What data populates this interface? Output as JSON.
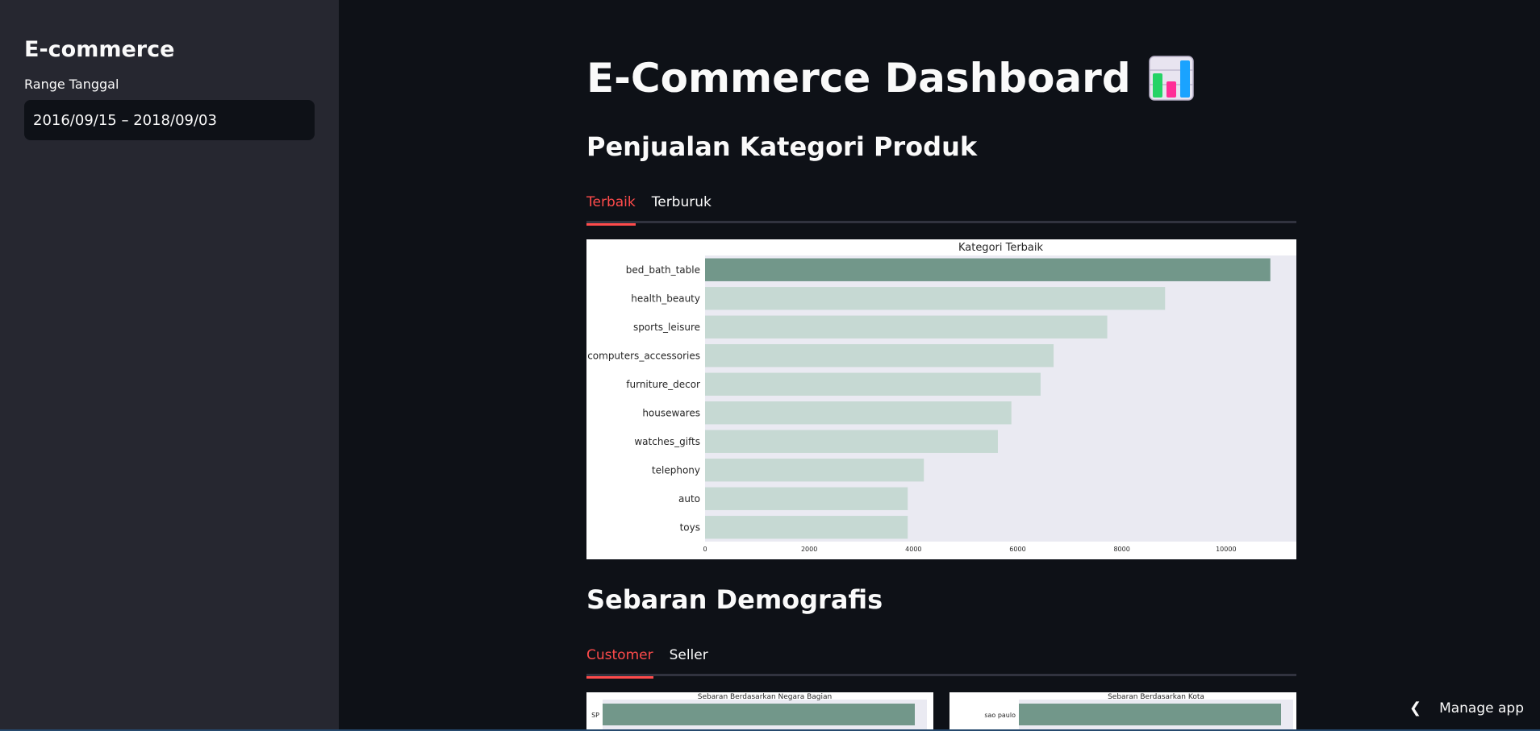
{
  "sidebar": {
    "title": "E-commerce",
    "date_label": "Range Tanggal",
    "date_value": "2016/09/15 – 2018/09/03"
  },
  "main": {
    "title": "E-Commerce Dashboard",
    "title_icon": "bar-chart-icon",
    "section1": {
      "heading": "Penjualan Kategori Produk",
      "tabs": [
        {
          "label": "Terbaik",
          "active": true
        },
        {
          "label": "Terburuk",
          "active": false
        }
      ]
    },
    "section2": {
      "heading": "Sebaran Demografis",
      "tabs": [
        {
          "label": "Customer",
          "active": true
        },
        {
          "label": "Seller",
          "active": false
        }
      ]
    }
  },
  "manage_app": "Manage app",
  "colors": {
    "accent": "#ff4b4b",
    "bar_top": "#72978a",
    "bar_rest": "#c6d9d3",
    "plot_bg": "#eaeaf2"
  },
  "chart_data": [
    {
      "type": "bar",
      "orientation": "horizontal",
      "title": "Kategori Terbaik",
      "categories": [
        "bed_bath_table",
        "health_beauty",
        "sports_leisure",
        "computers_accessories",
        "furniture_decor",
        "housewares",
        "watches_gifts",
        "telephony",
        "auto",
        "toys"
      ],
      "values": [
        10850,
        8830,
        7720,
        6690,
        6440,
        5880,
        5620,
        4200,
        3890,
        3890
      ],
      "xticks": [
        0,
        2000,
        4000,
        6000,
        8000,
        10000
      ],
      "xlim": [
        0,
        11350
      ],
      "grid": false
    },
    {
      "type": "bar",
      "orientation": "horizontal",
      "title": "Sebaran Berdasarkan Negara Bagian",
      "categories": [
        "SP"
      ],
      "values": [
        1.0
      ]
    },
    {
      "type": "bar",
      "orientation": "horizontal",
      "title": "Sebaran Berdasarkan Kota",
      "categories": [
        "sao paulo"
      ],
      "values": [
        1.0
      ]
    }
  ]
}
